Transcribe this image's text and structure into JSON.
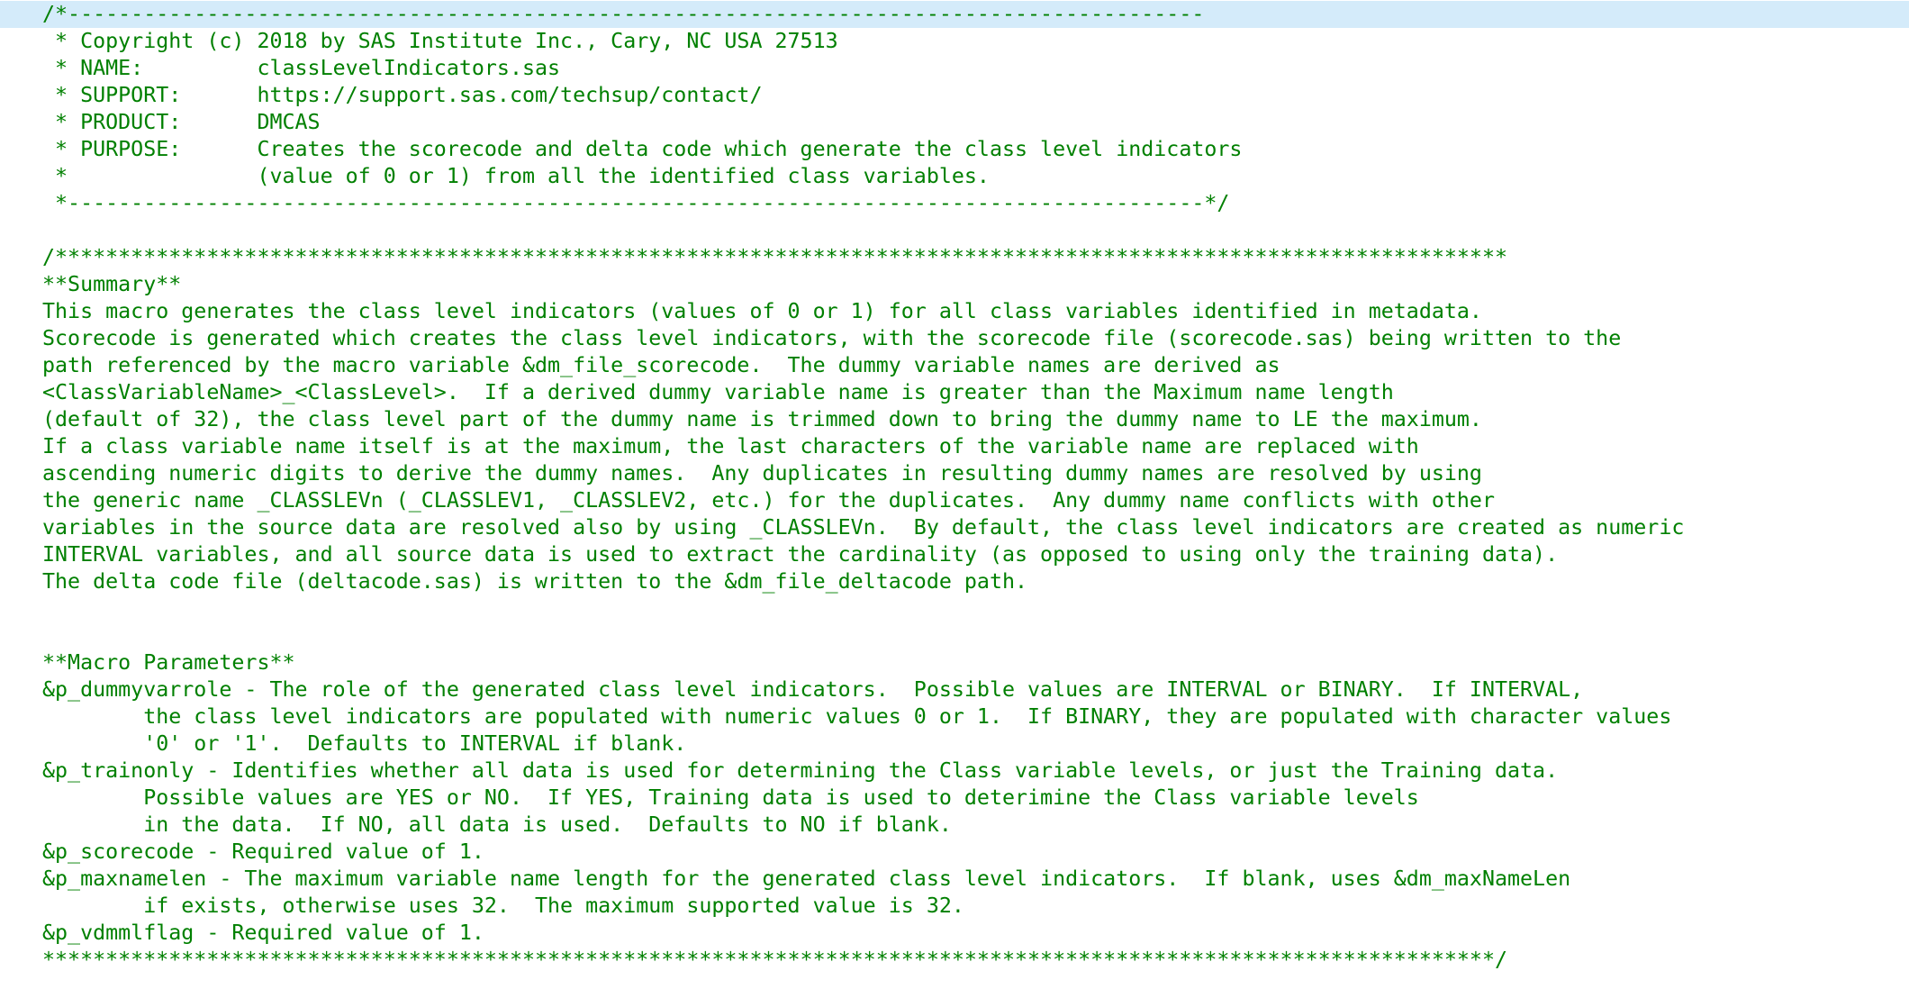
{
  "editor": {
    "current_line": 0,
    "text_color": "#008000",
    "current_line_bg": "#d4ebfa",
    "lines": [
      "/*------------------------------------------------------------------------------------------",
      " * Copyright (c) 2018 by SAS Institute Inc., Cary, NC USA 27513",
      " * NAME:         classLevelIndicators.sas",
      " * SUPPORT:      https://support.sas.com/techsup/contact/",
      " * PRODUCT:      DMCAS",
      " * PURPOSE:      Creates the scorecode and delta code which generate the class level indicators",
      " *               (value of 0 or 1) from all the identified class variables.",
      " *------------------------------------------------------------------------------------------*/",
      "",
      "/*******************************************************************************************************************",
      "**Summary**",
      "This macro generates the class level indicators (values of 0 or 1) for all class variables identified in metadata.",
      "Scorecode is generated which creates the class level indicators, with the scorecode file (scorecode.sas) being written to the",
      "path referenced by the macro variable &dm_file_scorecode.  The dummy variable names are derived as",
      "<ClassVariableName>_<ClassLevel>.  If a derived dummy variable name is greater than the Maximum name length",
      "(default of 32), the class level part of the dummy name is trimmed down to bring the dummy name to LE the maximum.",
      "If a class variable name itself is at the maximum, the last characters of the variable name are replaced with",
      "ascending numeric digits to derive the dummy names.  Any duplicates in resulting dummy names are resolved by using",
      "the generic name _CLASSLEVn (_CLASSLEV1, _CLASSLEV2, etc.) for the duplicates.  Any dummy name conflicts with other",
      "variables in the source data are resolved also by using _CLASSLEVn.  By default, the class level indicators are created as numeric",
      "INTERVAL variables, and all source data is used to extract the cardinality (as opposed to using only the training data).",
      "The delta code file (deltacode.sas) is written to the &dm_file_deltacode path.",
      "",
      "",
      "**Macro Parameters**",
      "&p_dummyvarrole - The role of the generated class level indicators.  Possible values are INTERVAL or BINARY.  If INTERVAL,",
      "        the class level indicators are populated with numeric values 0 or 1.  If BINARY, they are populated with character values",
      "        '0' or '1'.  Defaults to INTERVAL if blank.",
      "&p_trainonly - Identifies whether all data is used for determining the Class variable levels, or just the Training data.",
      "        Possible values are YES or NO.  If YES, Training data is used to deterimine the Class variable levels",
      "        in the data.  If NO, all data is used.  Defaults to NO if blank.",
      "&p_scorecode - Required value of 1.",
      "&p_maxnamelen - The maximum variable name length for the generated class level indicators.  If blank, uses &dm_maxNameLen",
      "        if exists, otherwise uses 32.  The maximum supported value is 32.",
      "&p_vdmmlflag - Required value of 1.",
      "*******************************************************************************************************************/"
    ]
  }
}
